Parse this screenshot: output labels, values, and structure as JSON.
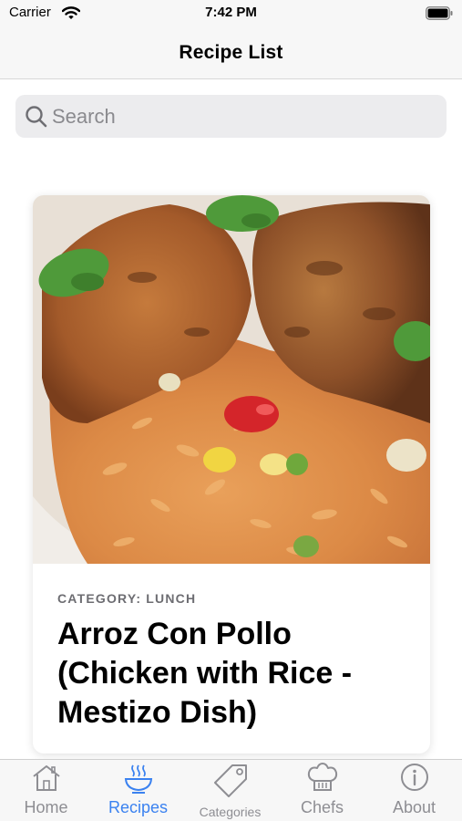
{
  "status_bar": {
    "carrier": "Carrier",
    "time": "7:42 PM"
  },
  "nav": {
    "title": "Recipe List"
  },
  "search": {
    "placeholder": "Search",
    "value": ""
  },
  "recipes": [
    {
      "category": "CATEGORY: LUNCH",
      "title": "Arroz Con Pollo (Chicken with Rice - Mestizo Dish)"
    }
  ],
  "tabs": [
    {
      "label": "Home",
      "icon": "house-icon",
      "active": false
    },
    {
      "label": "Recipes",
      "icon": "bowl-icon",
      "active": true
    },
    {
      "label": "Categories",
      "icon": "tag-icon",
      "active": false
    },
    {
      "label": "Chefs",
      "icon": "chef-hat-icon",
      "active": false
    },
    {
      "label": "About",
      "icon": "info-icon",
      "active": false
    }
  ],
  "colors": {
    "accent": "#3b82f0",
    "tab_inactive": "#8e8e93",
    "bar_background": "#f7f7f7"
  }
}
